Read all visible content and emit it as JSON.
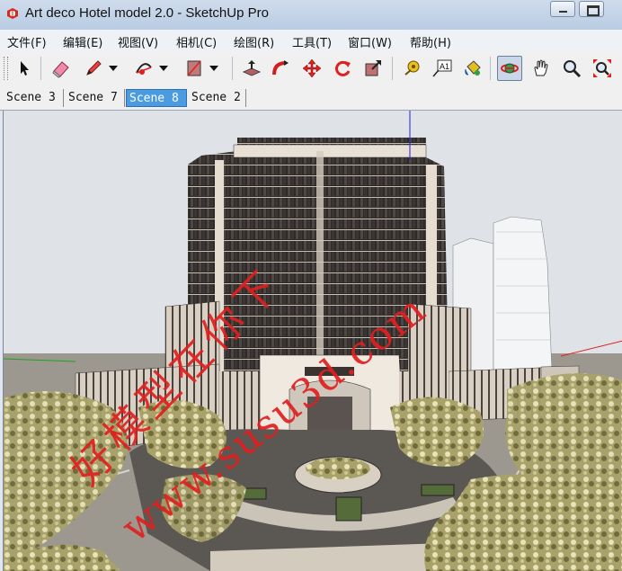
{
  "window": {
    "title": "Art deco Hotel model 2.0 - SketchUp Pro",
    "app_icon": "sketchup-logo"
  },
  "menu": [
    "文件(F)",
    "编辑(E)",
    "视图(V)",
    "相机(C)",
    "绘图(R)",
    "工具(T)",
    "窗口(W)",
    "帮助(H)"
  ],
  "toolbar": {
    "tools": [
      "select",
      "eraser",
      "pencil-line",
      "arc",
      "rectangle",
      "push-pull",
      "follow-me",
      "move",
      "rotate",
      "scale",
      "tape-measure",
      "text",
      "paint-bucket",
      "orbit",
      "pan",
      "zoom",
      "zoom-extents"
    ],
    "text_tool_label": "A1",
    "active_tool": "orbit"
  },
  "scenes": {
    "tabs": [
      "Scene 3",
      "Scene 7",
      "Scene 8",
      "Scene 2"
    ],
    "active": "Scene 8"
  },
  "viewport": {
    "watermark_line1": "好模型在你下",
    "watermark_line2": "www.susu3d.com",
    "watermark_color": "#e02020"
  }
}
